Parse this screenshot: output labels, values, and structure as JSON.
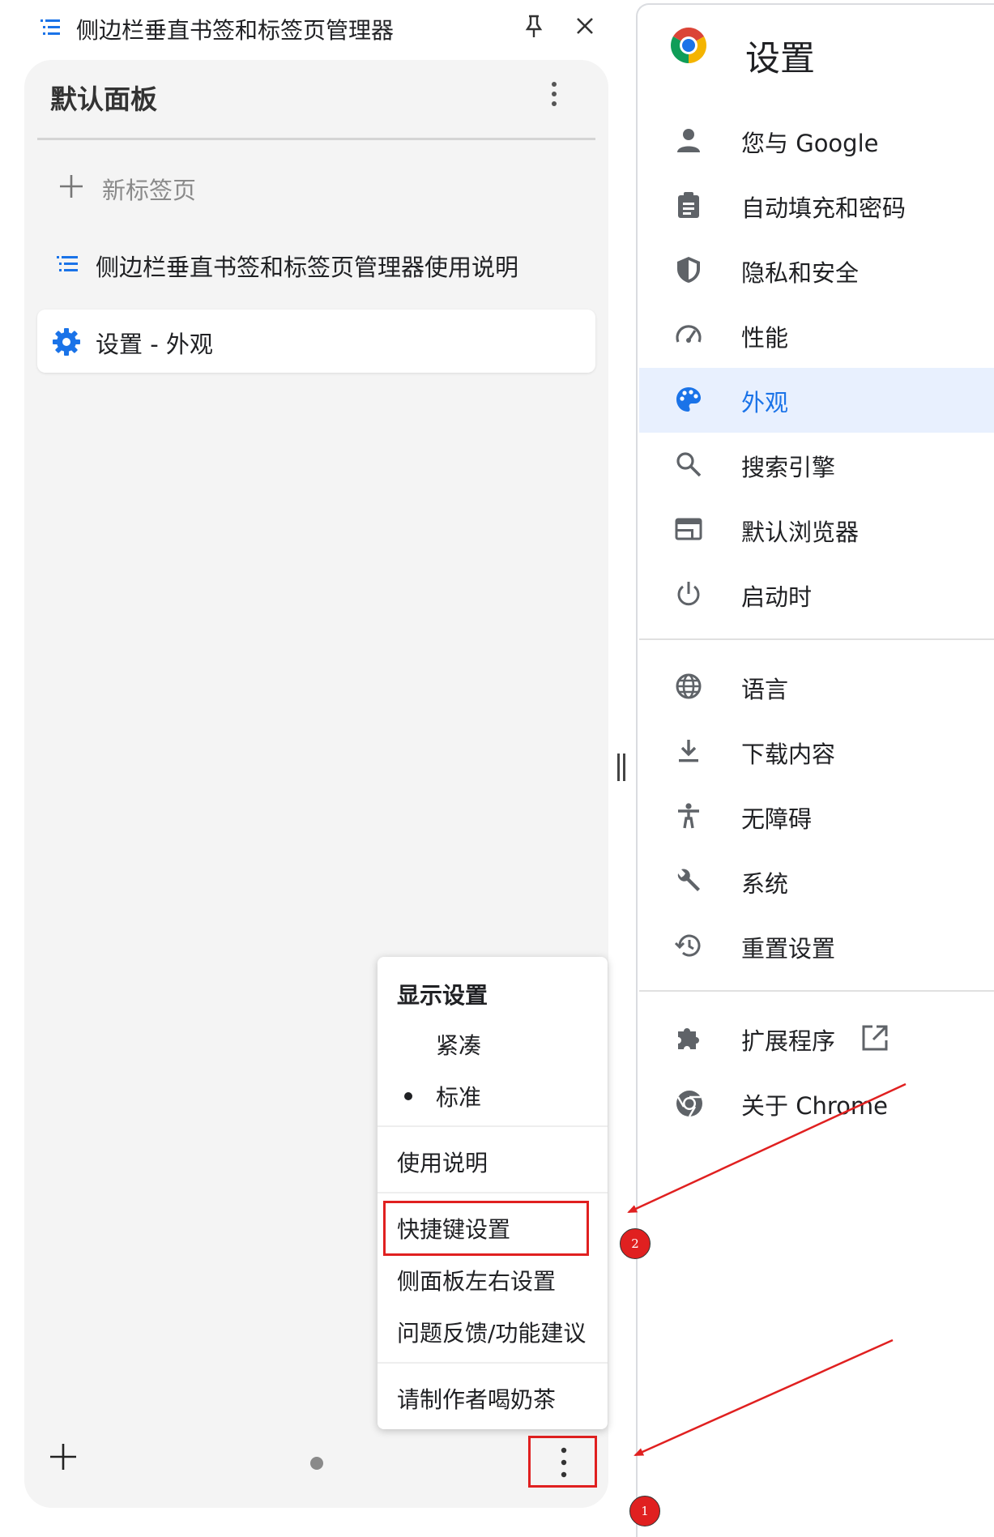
{
  "side_panel": {
    "window_title": "侧边栏垂直书签和标签页管理器",
    "panel_title": "默认面板",
    "items": [
      {
        "label": "新标签页"
      },
      {
        "label": "侧边栏垂直书签和标签页管理器使用说明"
      },
      {
        "label": "设置 - 外观"
      }
    ]
  },
  "popup_menu": {
    "heading": "显示设置",
    "density_options": [
      {
        "label": "紧凑",
        "selected": false
      },
      {
        "label": "标准",
        "selected": true
      }
    ],
    "items": [
      {
        "label": "使用说明"
      },
      {
        "label": "快捷键设置"
      },
      {
        "label": "侧面板左右设置"
      },
      {
        "label": "问题反馈/功能建议"
      },
      {
        "label": "请制作者喝奶茶"
      }
    ]
  },
  "settings": {
    "title": "设置",
    "nav": [
      {
        "label": "您与 Google",
        "icon": "person-icon"
      },
      {
        "label": "自动填充和密码",
        "icon": "clipboard-icon"
      },
      {
        "label": "隐私和安全",
        "icon": "shield-icon"
      },
      {
        "label": "性能",
        "icon": "speedometer-icon"
      },
      {
        "label": "外观",
        "icon": "palette-icon",
        "active": true
      },
      {
        "label": "搜索引擎",
        "icon": "search-icon"
      },
      {
        "label": "默认浏览器",
        "icon": "browser-icon"
      },
      {
        "label": "启动时",
        "icon": "power-icon"
      },
      {
        "label": "语言",
        "icon": "globe-icon"
      },
      {
        "label": "下载内容",
        "icon": "download-icon"
      },
      {
        "label": "无障碍",
        "icon": "accessibility-icon"
      },
      {
        "label": "系统",
        "icon": "wrench-icon"
      },
      {
        "label": "重置设置",
        "icon": "history-icon"
      },
      {
        "label": "扩展程序",
        "icon": "puzzle-icon"
      },
      {
        "label": "关于 Chrome",
        "icon": "chrome-icon"
      }
    ]
  },
  "annotations": {
    "badge_1": "1",
    "badge_2": "2"
  },
  "colors": {
    "accent_blue": "#1a73e8",
    "annotation_red": "#e02020",
    "active_bg": "#e8f0fe"
  }
}
